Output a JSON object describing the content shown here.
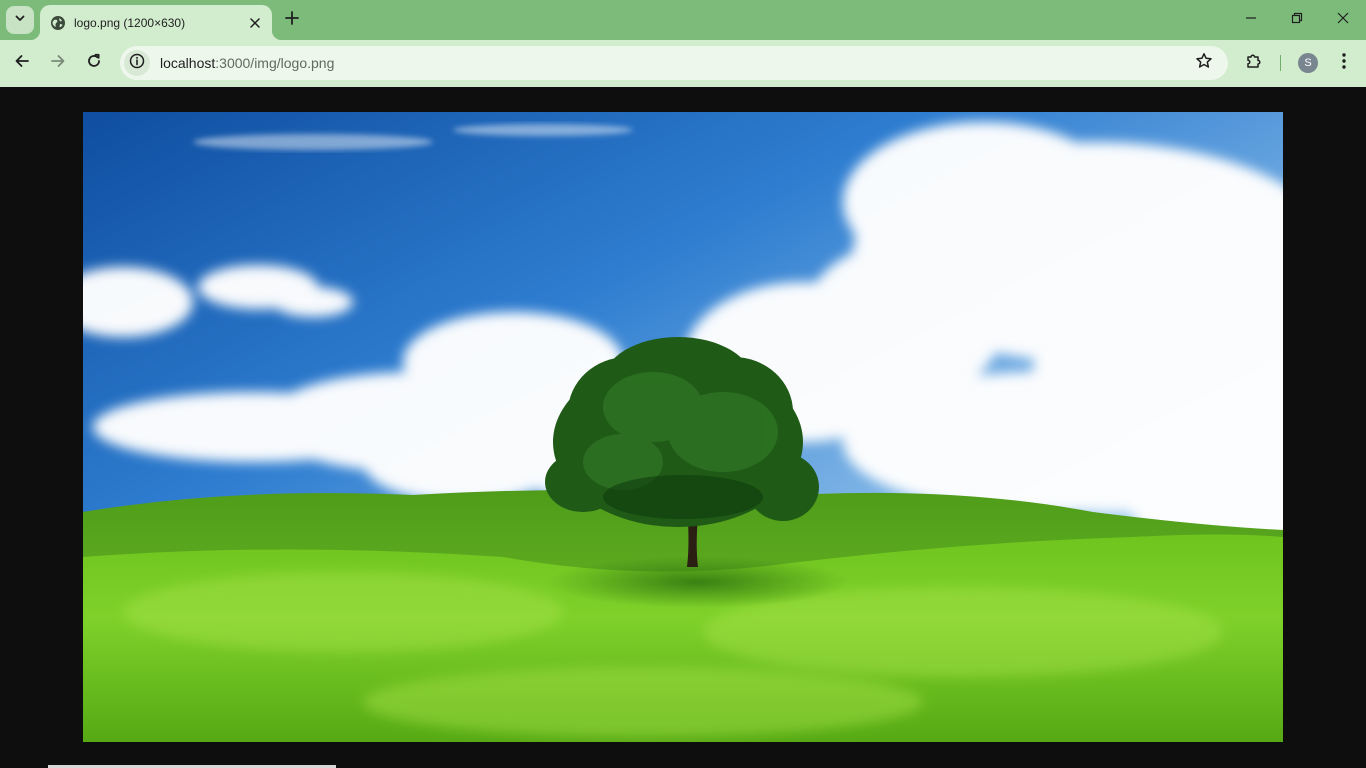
{
  "tab": {
    "title": "logo.png (1200×630)"
  },
  "toolbar": {
    "url_host": "localhost",
    "url_path": ":3000/img/logo.png",
    "profile_initial": "S"
  },
  "icons": {
    "tab_search": "chevron-down-icon",
    "favicon": "globe-icon",
    "tab_close": "close-icon",
    "new_tab": "plus-icon",
    "minimize": "minimize-icon",
    "restore": "restore-icon",
    "window_close": "close-icon",
    "back": "arrow-left-icon",
    "forward": "arrow-right-icon",
    "reload": "reload-icon",
    "site_info": "info-icon",
    "bookmark": "star-icon",
    "extensions": "puzzle-icon",
    "menu": "more-vertical-icon"
  },
  "colors": {
    "tab_strip": "#7dbb7b",
    "toolbar": "#d2ecce",
    "viewer_background": "#0e0e0e"
  }
}
